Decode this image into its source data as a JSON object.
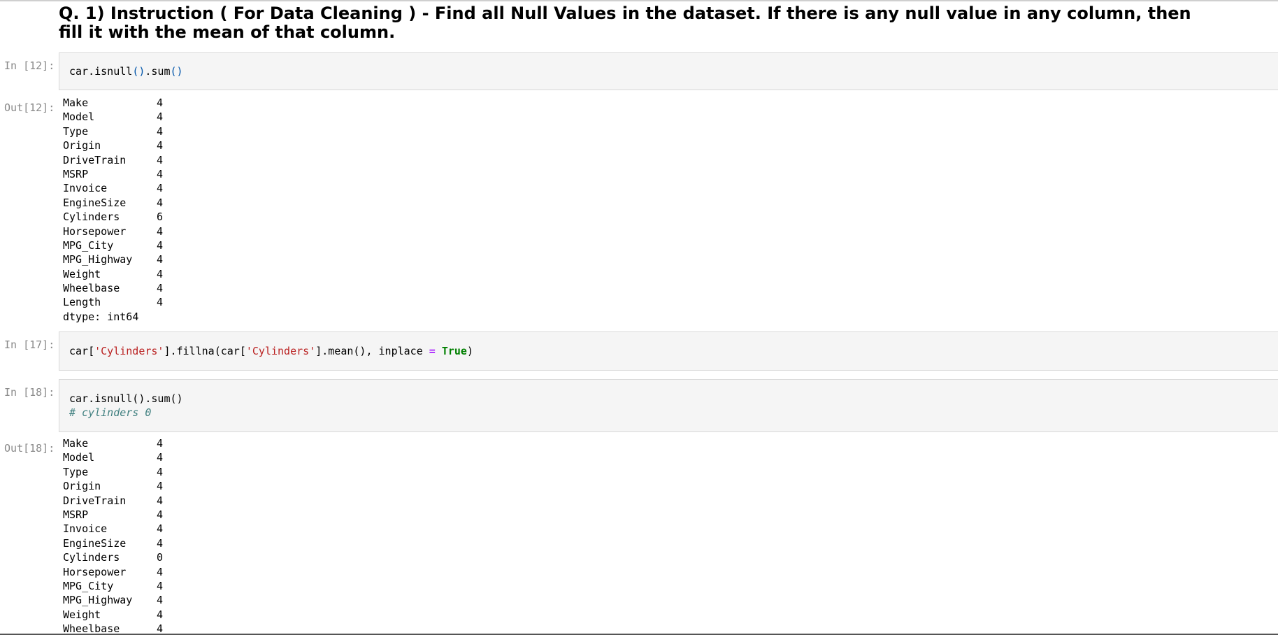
{
  "heading": "Q. 1) Instruction ( For Data Cleaning ) - Find all Null Values in the dataset. If there is any null value in any column, then fill it with the mean of that column.",
  "cells": {
    "in12": {
      "prompt": "In [12]:",
      "code": {
        "obj": "car",
        "dot1": ".",
        "method1": "isnull",
        "paren1": "()",
        "dot2": ".",
        "method2": "sum",
        "paren2": "()"
      }
    },
    "out12": {
      "prompt": "Out[12]:",
      "rows": [
        {
          "name": "Make",
          "value": "4"
        },
        {
          "name": "Model",
          "value": "4"
        },
        {
          "name": "Type",
          "value": "4"
        },
        {
          "name": "Origin",
          "value": "4"
        },
        {
          "name": "DriveTrain",
          "value": "4"
        },
        {
          "name": "MSRP",
          "value": "4"
        },
        {
          "name": "Invoice",
          "value": "4"
        },
        {
          "name": "EngineSize",
          "value": "4"
        },
        {
          "name": "Cylinders",
          "value": "6"
        },
        {
          "name": "Horsepower",
          "value": "4"
        },
        {
          "name": "MPG_City",
          "value": "4"
        },
        {
          "name": "MPG_Highway",
          "value": "4"
        },
        {
          "name": "Weight",
          "value": "4"
        },
        {
          "name": "Wheelbase",
          "value": "4"
        },
        {
          "name": "Length",
          "value": "4"
        }
      ],
      "dtype": "dtype: int64"
    },
    "in17": {
      "prompt": "In [17]:",
      "code": {
        "part1": "car[",
        "str1": "'Cylinders'",
        "part2": "].fillna(car[",
        "str2": "'Cylinders'",
        "part3": "].mean(), inplace ",
        "op": "=",
        "space": " ",
        "kw": "True",
        "part4": ")"
      }
    },
    "in18": {
      "prompt": "In [18]:",
      "code": {
        "line1": "car.isnull().sum()",
        "comment": "# cylinders 0"
      }
    },
    "out18": {
      "prompt": "Out[18]:",
      "rows": [
        {
          "name": "Make",
          "value": "4"
        },
        {
          "name": "Model",
          "value": "4"
        },
        {
          "name": "Type",
          "value": "4"
        },
        {
          "name": "Origin",
          "value": "4"
        },
        {
          "name": "DriveTrain",
          "value": "4"
        },
        {
          "name": "MSRP",
          "value": "4"
        },
        {
          "name": "Invoice",
          "value": "4"
        },
        {
          "name": "EngineSize",
          "value": "4"
        },
        {
          "name": "Cylinders",
          "value": "0"
        },
        {
          "name": "Horsepower",
          "value": "4"
        },
        {
          "name": "MPG_City",
          "value": "4"
        },
        {
          "name": "MPG_Highway",
          "value": "4"
        },
        {
          "name": "Weight",
          "value": "4"
        },
        {
          "name": "Wheelbase",
          "value": "4"
        }
      ]
    }
  }
}
